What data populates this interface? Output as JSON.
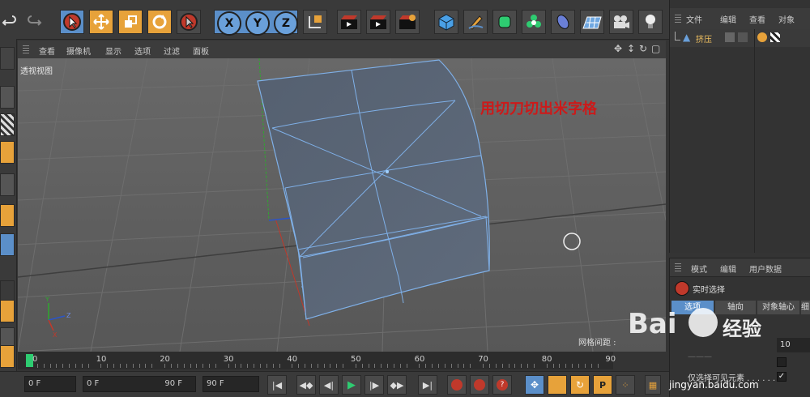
{
  "object_manager": {
    "menu": [
      "文件",
      "编辑",
      "查看",
      "对象"
    ],
    "object_name": "挤压"
  },
  "viewport": {
    "menu": [
      "查看",
      "摄像机",
      "显示",
      "选项",
      "过滤",
      "面板"
    ],
    "label": "透视视图",
    "annotation": "用切刀切出米字格",
    "grid_spacing_label": "网格间距 :"
  },
  "attributes": {
    "menu": [
      "模式",
      "编辑",
      "用户数据"
    ],
    "tool_name": "实时选择",
    "tabs": [
      "选项",
      "轴向",
      "对象轴心",
      "细"
    ],
    "radius_value": "10",
    "visible_only_label": "仅选择可见元素 . . . . . ."
  },
  "timeline": {
    "ticks": [
      "0",
      "10",
      "20",
      "30",
      "40",
      "50",
      "60",
      "70",
      "80",
      "90"
    ]
  },
  "transport": {
    "current_frame": "0 F",
    "range_start": "0 F",
    "range_end": "90 F",
    "end_frame": "90 F"
  },
  "watermark": {
    "site": "jingyan.baidu.com",
    "brand": "Bai",
    "brand2": "经验"
  },
  "colors": {
    "accent_blue": "#5b8fc9",
    "accent_orange": "#e7a23a",
    "annotation_red": "#cc1a1a"
  }
}
